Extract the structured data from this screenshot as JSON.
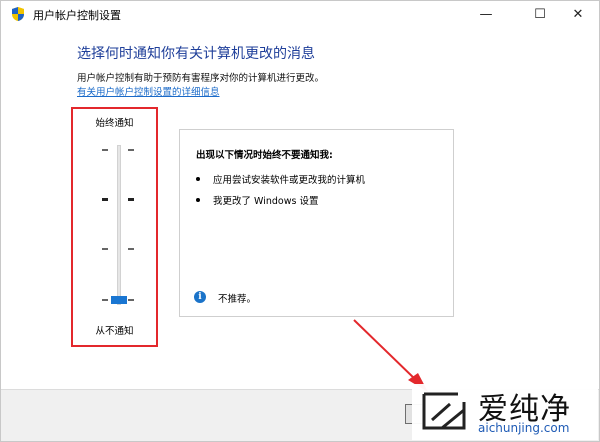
{
  "window": {
    "title": "用户帐户控制设置",
    "minimize_glyph": "—",
    "maximize_glyph": "☐",
    "close_glyph": "✕"
  },
  "main": {
    "heading": "选择何时通知你有关计算机更改的消息",
    "description": "用户帐户控制有助于预防有害程序对你的计算机进行更改。",
    "help_link": "有关用户帐户控制设置的详细信息"
  },
  "slider": {
    "top_label": "始终通知",
    "bottom_label": "从不通知",
    "levels": 4,
    "selected_level": 1
  },
  "panel": {
    "title": "出现以下情况时始终不要通知我:",
    "bullets": [
      "应用尝试安装软件或更改我的计算机",
      "我更改了 Windows 设置"
    ],
    "note": "不推荐。",
    "info_glyph": "i"
  },
  "watermark": {
    "name": "爱纯净",
    "url": "aichunjing.com"
  },
  "colors": {
    "heading": "#1f3f9a",
    "link": "#1a6ac9",
    "highlight_border": "#e3282c",
    "slider_thumb": "#1976d2"
  }
}
